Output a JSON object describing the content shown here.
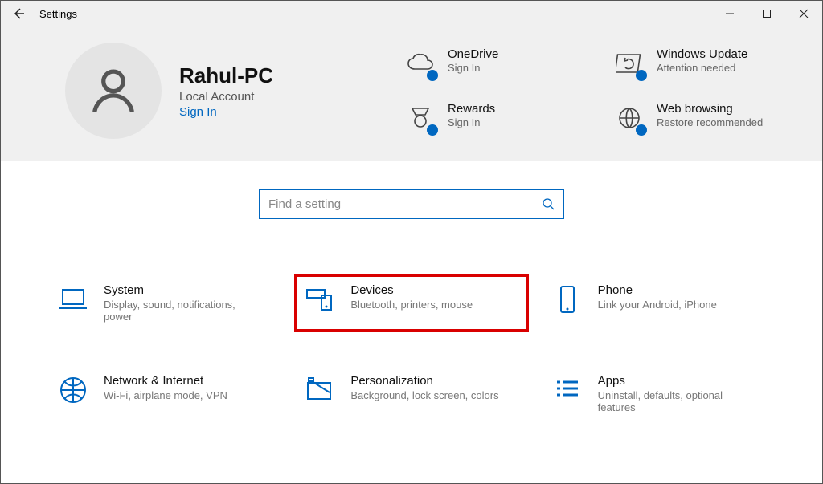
{
  "window": {
    "title": "Settings"
  },
  "user": {
    "name": "Rahul-PC",
    "account_type": "Local Account",
    "signin_label": "Sign In"
  },
  "tiles": {
    "onedrive": {
      "title": "OneDrive",
      "sub": "Sign In"
    },
    "update": {
      "title": "Windows Update",
      "sub": "Attention needed"
    },
    "rewards": {
      "title": "Rewards",
      "sub": "Sign In"
    },
    "browsing": {
      "title": "Web browsing",
      "sub": "Restore recommended"
    }
  },
  "search": {
    "placeholder": "Find a setting"
  },
  "categories": {
    "system": {
      "title": "System",
      "sub": "Display, sound, notifications, power"
    },
    "devices": {
      "title": "Devices",
      "sub": "Bluetooth, printers, mouse"
    },
    "phone": {
      "title": "Phone",
      "sub": "Link your Android, iPhone"
    },
    "network": {
      "title": "Network & Internet",
      "sub": "Wi-Fi, airplane mode, VPN"
    },
    "personal": {
      "title": "Personalization",
      "sub": "Background, lock screen, colors"
    },
    "apps": {
      "title": "Apps",
      "sub": "Uninstall, defaults, optional features"
    }
  },
  "colors": {
    "accent": "#0067c0",
    "highlight": "#d90000"
  }
}
